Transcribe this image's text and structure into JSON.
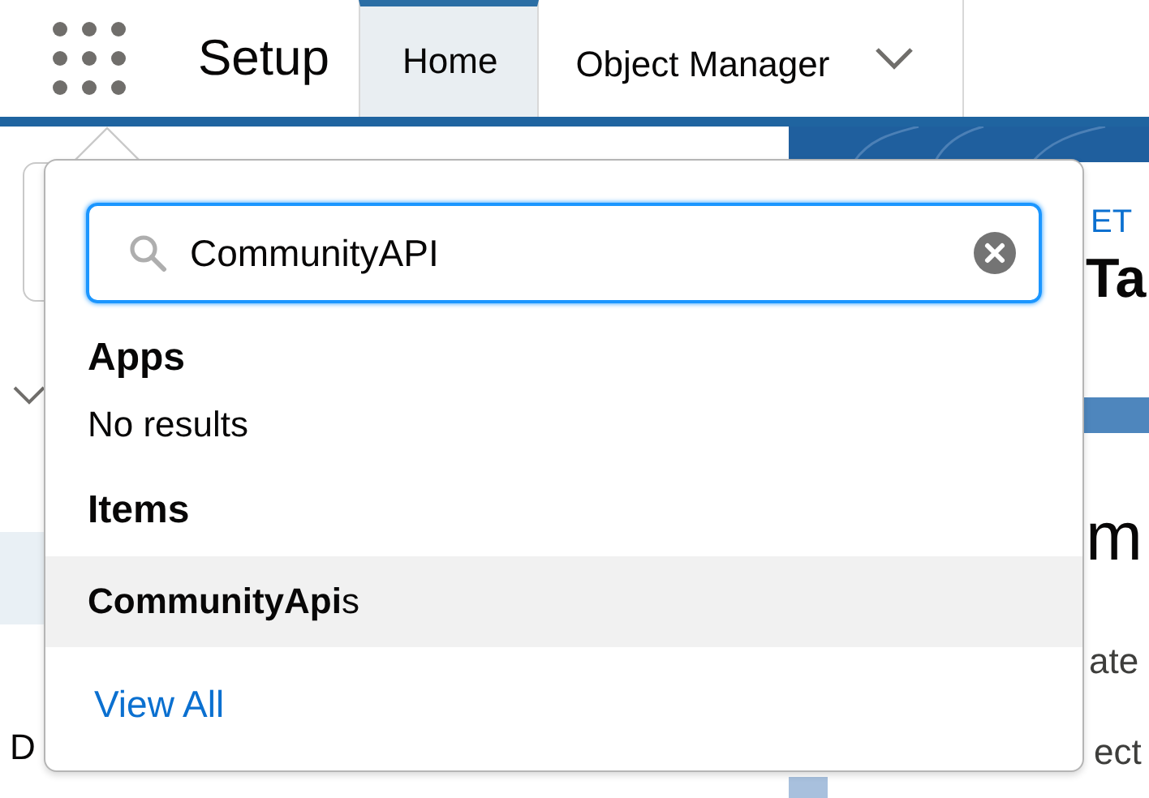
{
  "header": {
    "title": "Setup",
    "tabs": [
      {
        "label": "Home",
        "selected": true
      },
      {
        "label": "Object Manager",
        "selected": false
      }
    ]
  },
  "background": {
    "right": {
      "eyebrow": "ET",
      "heading": "Ta",
      "title": "m",
      "line_1": "ate",
      "line_2": "ect"
    },
    "left": {
      "line_1": "D"
    }
  },
  "popover": {
    "search": {
      "value": "CommunityAPI"
    },
    "sections": [
      {
        "heading": "Apps",
        "empty_text": "No results"
      },
      {
        "heading": "Items",
        "results": [
          {
            "label": "**CommunityApi**s",
            "selected": true
          }
        ]
      }
    ],
    "view_all": "View All"
  }
}
